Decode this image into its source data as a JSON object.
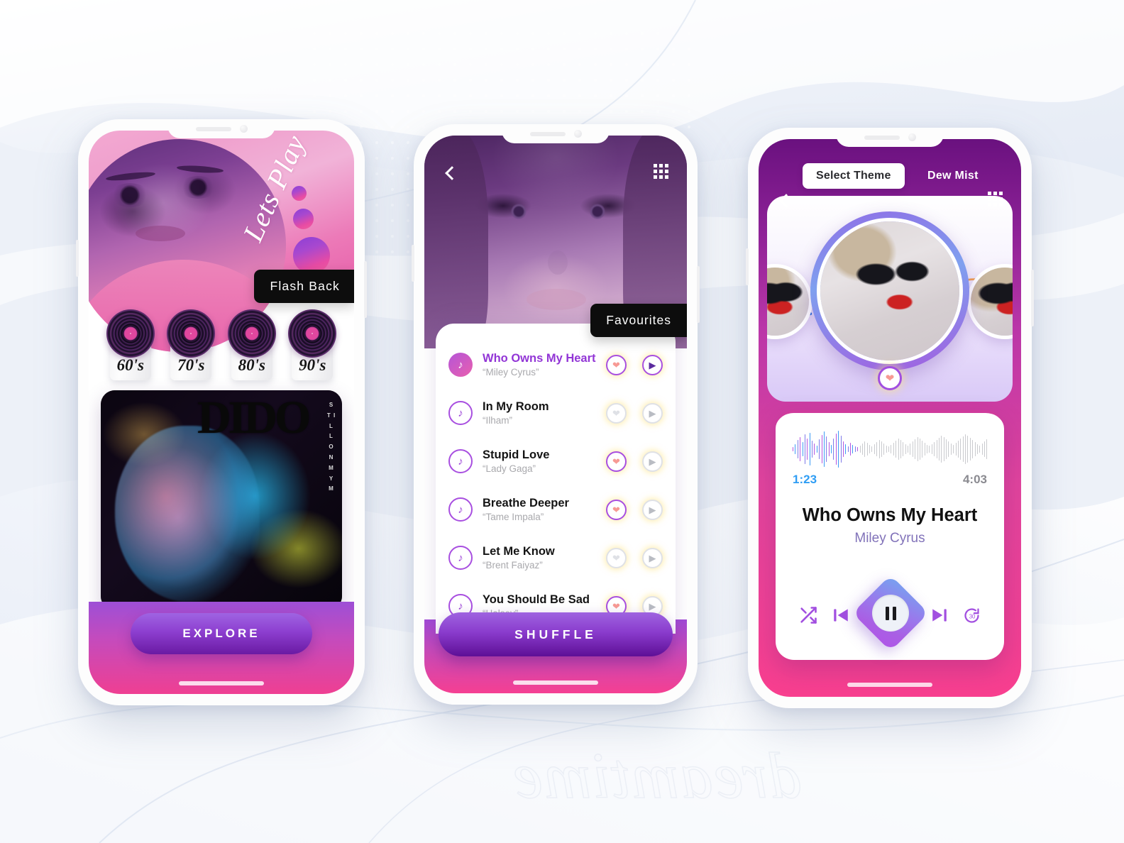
{
  "background": {
    "watermark_text": "dreamtime"
  },
  "phone1": {
    "name": "Flash Back home screen",
    "hero": {
      "script_text": "Lets Play",
      "badge": "Flash Back"
    },
    "decades": [
      {
        "label": "60's"
      },
      {
        "label": "70's"
      },
      {
        "label": "80's"
      },
      {
        "label": "90's"
      }
    ],
    "album": {
      "artist": "DIDO",
      "vertical_text": "S T I L L   O N   M Y   M"
    },
    "cta": {
      "label": "EXPLORE"
    }
  },
  "phone2": {
    "name": "Favourites playlist screen",
    "badge": "Favourites",
    "icons": {
      "back": "back-chevron",
      "grid": "grid-menu"
    },
    "tracks": [
      {
        "title": "Who Owns My Heart",
        "artist": "“Miley Cyrus”",
        "active": true,
        "favourite": true,
        "playing": true
      },
      {
        "title": "In My Room",
        "artist": "“Ilham”",
        "active": false,
        "favourite": false,
        "playing": false
      },
      {
        "title": "Stupid Love",
        "artist": "“Lady Gaga”",
        "active": false,
        "favourite": true,
        "playing": false
      },
      {
        "title": "Breathe Deeper",
        "artist": "“Tame Impala”",
        "active": false,
        "favourite": true,
        "playing": false
      },
      {
        "title": "Let Me Know",
        "artist": "“Brent Faiyaz”",
        "active": false,
        "favourite": false,
        "playing": false
      },
      {
        "title": "You Should Be Sad",
        "artist": "“Halsey”",
        "active": false,
        "favourite": true,
        "playing": false
      }
    ],
    "cta": {
      "label": "SHUFFLE"
    }
  },
  "phone3": {
    "name": "Now playing screen",
    "header": {
      "theme_button": "Select Theme",
      "theme_name": "Dew Mist"
    },
    "player": {
      "current_time": "1:23",
      "total_time": "4:03",
      "title": "Who Owns My Heart",
      "artist": "Miley Cyrus",
      "progress_percent": 34
    },
    "controls": [
      {
        "name": "shuffle-button",
        "glyph": "shuffle"
      },
      {
        "name": "previous-button",
        "glyph": "prev"
      },
      {
        "name": "play-pause-button",
        "glyph": "pause"
      },
      {
        "name": "next-button",
        "glyph": "next"
      },
      {
        "name": "replay-30-button",
        "glyph": "replay30",
        "seconds": "30"
      }
    ]
  },
  "colors": {
    "accent_purple": "#a24fe0",
    "accent_pink": "#ef3f92",
    "accent_blue": "#2f9df4",
    "heart_on": "#f79a94",
    "heart_off": "#dfe1e6",
    "badge_bg": "#0d0d0d"
  }
}
